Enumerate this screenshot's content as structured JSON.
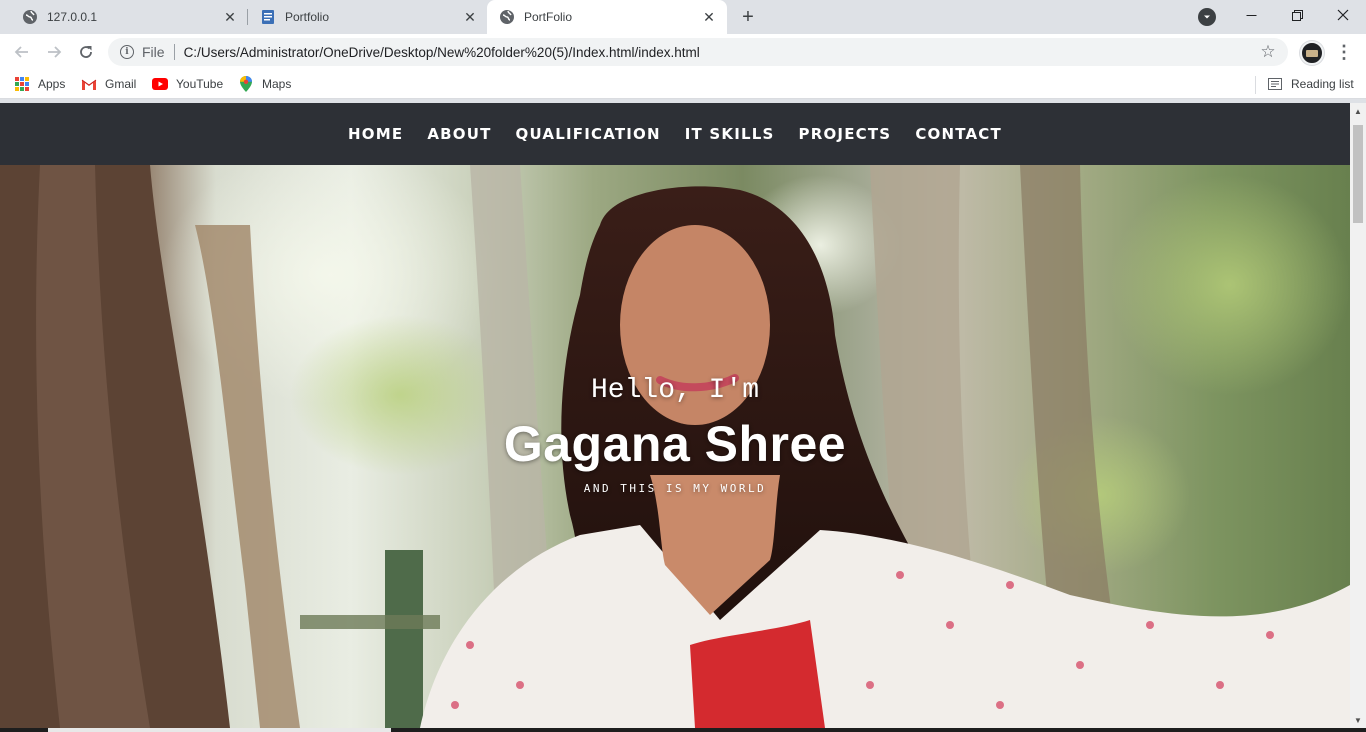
{
  "browser": {
    "tabs": [
      {
        "title": "127.0.0.1",
        "favicon": "globe-icon",
        "active": false
      },
      {
        "title": "Portfolio",
        "favicon": "document-icon",
        "active": false
      },
      {
        "title": "PortFolio",
        "favicon": "globe-icon",
        "active": true
      }
    ],
    "address": {
      "scheme": "File",
      "url": "C:/Users/Administrator/OneDrive/Desktop/New%20folder%20(5)/Index.html/index.html"
    },
    "bookmarks": [
      {
        "label": "Apps",
        "icon": "apps-grid-icon"
      },
      {
        "label": "Gmail",
        "icon": "gmail-icon"
      },
      {
        "label": "YouTube",
        "icon": "youtube-icon"
      },
      {
        "label": "Maps",
        "icon": "maps-pin-icon"
      }
    ],
    "reading_list": "Reading list"
  },
  "page": {
    "nav": [
      "HOME",
      "ABOUT",
      "QUALIFICATION",
      "IT SKILLS",
      "PROJECTS",
      "CONTACT"
    ],
    "hero": {
      "greeting": "Hello, I'm",
      "name": "Gagana Shree",
      "tagline": "AND THIS IS MY WORLD"
    }
  },
  "colors": {
    "nav_background": "#2d3036",
    "nav_text": "#ffffff",
    "tabstrip": "#dee1e6"
  }
}
